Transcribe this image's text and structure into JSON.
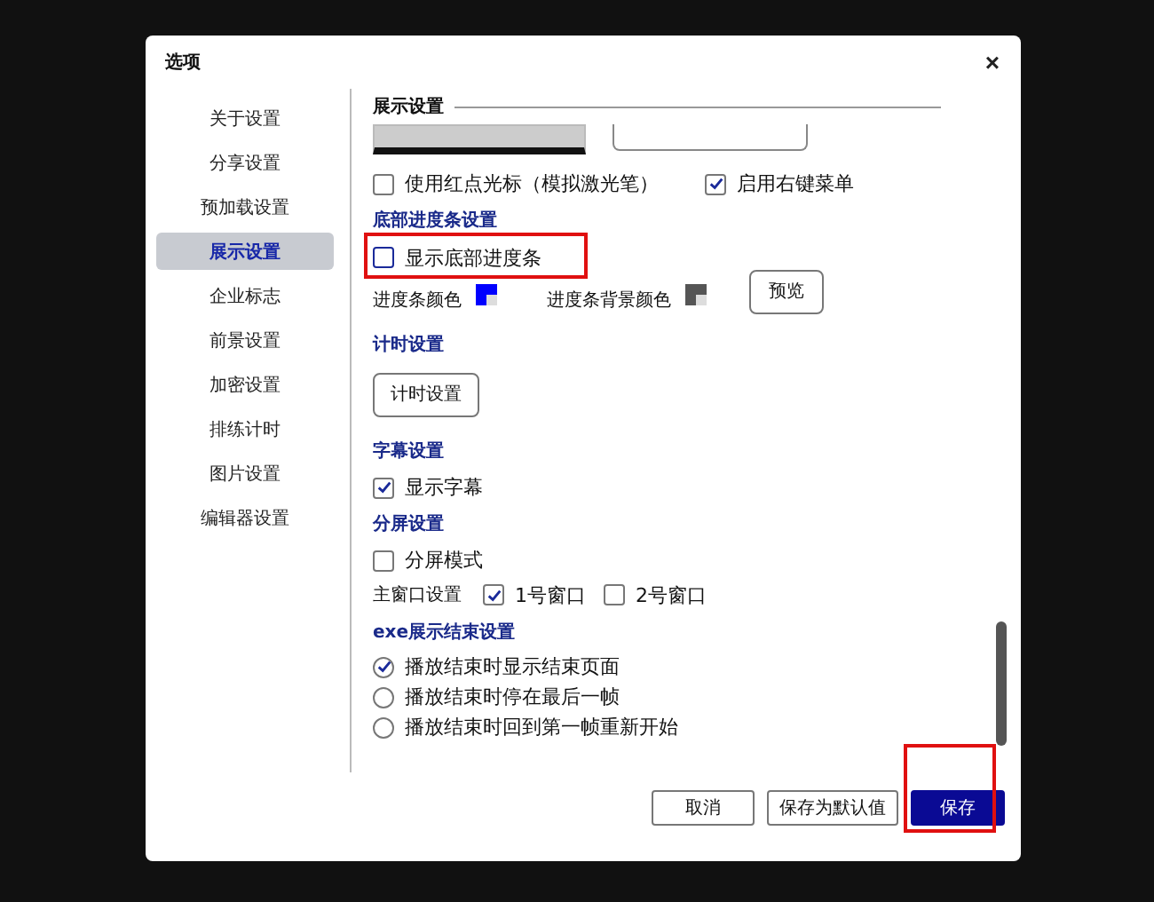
{
  "window": {
    "title": "选项",
    "close": "×"
  },
  "sidebar": {
    "items": [
      {
        "label": "关于设置",
        "selected": false
      },
      {
        "label": "分享设置",
        "selected": false
      },
      {
        "label": "预加载设置",
        "selected": false
      },
      {
        "label": "展示设置",
        "selected": true
      },
      {
        "label": "企业标志",
        "selected": false
      },
      {
        "label": "前景设置",
        "selected": false
      },
      {
        "label": "加密设置",
        "selected": false
      },
      {
        "label": "排练计时",
        "selected": false
      },
      {
        "label": "图片设置",
        "selected": false
      },
      {
        "label": "编辑器设置",
        "selected": false
      }
    ]
  },
  "heading": "展示设置",
  "cursor_options": [
    {
      "label": "使用红点光标（模拟激光笔）",
      "checked": false
    },
    {
      "label": "启用右键菜单",
      "checked": true
    }
  ],
  "progress_bar": {
    "title": "底部进度条设置",
    "show": {
      "label": "显示底部进度条",
      "checked": false,
      "highlighted": true
    },
    "colors": [
      {
        "label": "进度条颜色",
        "color": "#0000ff"
      },
      {
        "label": "进度条背景颜色",
        "color": "#555555"
      }
    ],
    "preview_button": "预览"
  },
  "timer": {
    "title": "计时设置",
    "button": "计时设置"
  },
  "subtitles": {
    "title": "字幕设置",
    "show": {
      "label": "显示字幕",
      "checked": true
    }
  },
  "split_screen": {
    "title": "分屏设置",
    "mode": {
      "label": "分屏模式",
      "checked": false
    },
    "main_window_label": "主窗口设置",
    "windows": [
      {
        "label": "1号窗口",
        "checked": true
      },
      {
        "label": "2号窗口",
        "checked": false
      }
    ]
  },
  "exe_end": {
    "title": "exe展示结束设置",
    "options": [
      {
        "label": "播放结束时显示结束页面",
        "selected": true
      },
      {
        "label": "播放结束时停在最后一帧",
        "selected": false
      },
      {
        "label": "播放结束时回到第一帧重新开始",
        "selected": false
      }
    ]
  },
  "buttons": [
    {
      "label": "取消",
      "kind": "normal",
      "highlighted": false
    },
    {
      "label": "保存为默认值",
      "kind": "normal",
      "highlighted": false
    },
    {
      "label": "保存",
      "kind": "primary",
      "highlighted": true
    }
  ]
}
